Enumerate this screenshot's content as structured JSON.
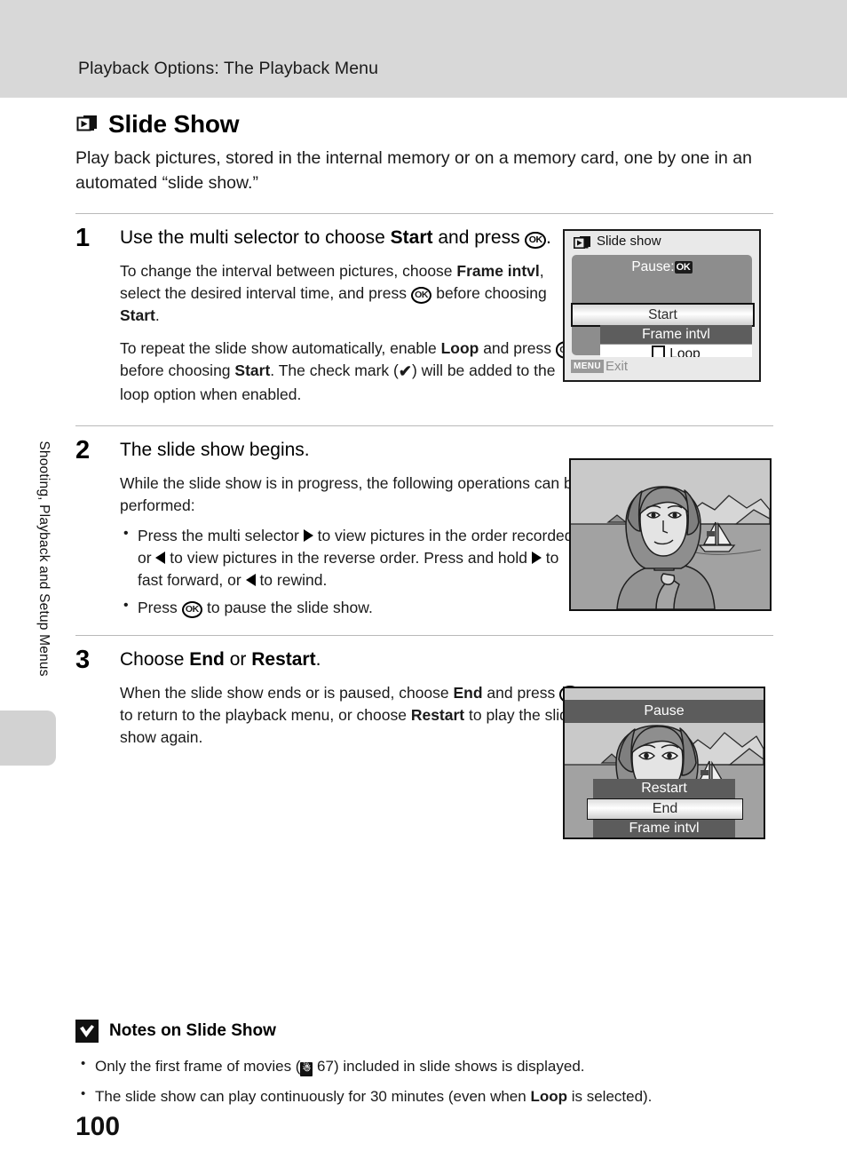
{
  "header": {
    "running_head": "Playback Options: The Playback Menu"
  },
  "side": {
    "chapter_tab_label": "Shooting, Playback and Setup Menus"
  },
  "section": {
    "icon": "slideshow-stack-icon",
    "title": "Slide Show",
    "intro": "Play back pictures, stored in the internal memory or on a memory card, one by one in an automated “slide show.”"
  },
  "steps": [
    {
      "number": "1",
      "head_pre": "Use the multi selector to choose ",
      "head_bold": "Start",
      "head_mid": " and press ",
      "head_ok": "OK",
      "head_post": ".",
      "paragraphs": [
        "To change the interval between pictures, choose Frame intvl, select the desired interval time, and press OK before choosing Start.",
        "To repeat the slide show automatically, enable Loop and press OK before choosing Start. The check mark (✔) will be added to the loop option when enabled."
      ]
    },
    {
      "number": "2",
      "head": "The slide show begins.",
      "lead": "While the slide show is in progress, the following operations can be performed:",
      "bullets": [
        "Press the multi selector ▶ to view pictures in the order recorded, or ◀ to view pictures in the reverse order. Press and hold ▶ to fast forward, or ◀ to rewind.",
        "Press OK to pause the slide show."
      ]
    },
    {
      "number": "3",
      "head_pre": "Choose ",
      "head_bold1": "End",
      "head_mid": " or ",
      "head_bold2": "Restart",
      "head_post": ".",
      "paragraph": "When the slide show ends or is paused, choose End and press OK to return to the playback menu, or choose Restart to play the slide show again."
    }
  ],
  "screens": {
    "slide_show_menu": {
      "icon": "slideshow-stack-icon",
      "title": "Slide show",
      "pause_label": "Pause:",
      "pause_badge": "OK",
      "items": [
        {
          "label": "Start",
          "state": "selected"
        },
        {
          "label": "Frame intvl",
          "state": "normal"
        },
        {
          "label": "Loop",
          "state": "checkbox",
          "checked": false
        }
      ],
      "footer_badge": "MENU",
      "footer_label": "Exit"
    },
    "pause_screen": {
      "title": "Pause",
      "items": [
        {
          "label": "Restart",
          "state": "normal"
        },
        {
          "label": "End",
          "state": "selected"
        },
        {
          "label": "Frame intvl",
          "state": "normal"
        }
      ]
    }
  },
  "notes": {
    "icon": "checkmark-note-icon",
    "title": "Notes on Slide Show",
    "items": [
      "Only the first frame of movies (⚙ 67) included in slide shows is displayed.",
      "The slide show can play continuously for 30 minutes (even when Loop is selected)."
    ],
    "note1_pre": "Only the first frame of movies (",
    "note1_page": " 67) included in slide shows is displayed.",
    "note2_pre": "The slide show can play continuously for 30 minutes (even when ",
    "note2_bold": "Loop",
    "note2_post": " is selected)."
  },
  "page_number": "100"
}
